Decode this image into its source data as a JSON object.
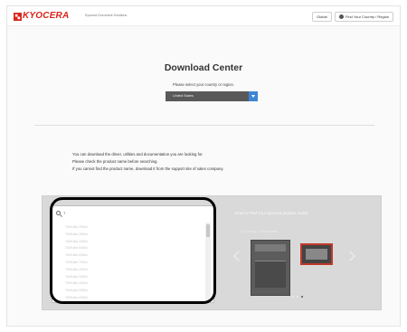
{
  "header": {
    "logo_text": "KYOCERA",
    "logo_subtitle": "Kyocera Document Solutions",
    "global_label": "Global",
    "region_label": "Find Your Country / Region"
  },
  "main": {
    "title": "Download Center",
    "subtitle": "Please select your country or region.",
    "country_select": "United States"
  },
  "notes": [
    "You can download the driver, utilities and documentation you are looking for.",
    "Please check the product name before searching.",
    "If you cannot find the product name, download it from the support site of sales company."
  ],
  "product_search": {
    "search_value": "T",
    "results": [
      "TASKalfa 2554ci",
      "TASKalfa 3554ci",
      "TASKalfa 4054ci",
      "TASKalfa 5054ci",
      "TASKalfa 6054ci",
      "TASKalfa 7054ci",
      "TASKalfa 2553ci",
      "TASKalfa 3253ci",
      "TASKalfa 4053ci",
      "TASKalfa 5053ci",
      "TASKalfa 6053ci"
    ]
  },
  "help": {
    "title": "How to Find Your kyocera product name",
    "slide_caption": "1. Go to step 1. Product label"
  },
  "colors": {
    "brand": "#d9241c",
    "accent_button": "#3d86d6",
    "select_bg": "#595959",
    "highlight_outline": "#000000"
  }
}
